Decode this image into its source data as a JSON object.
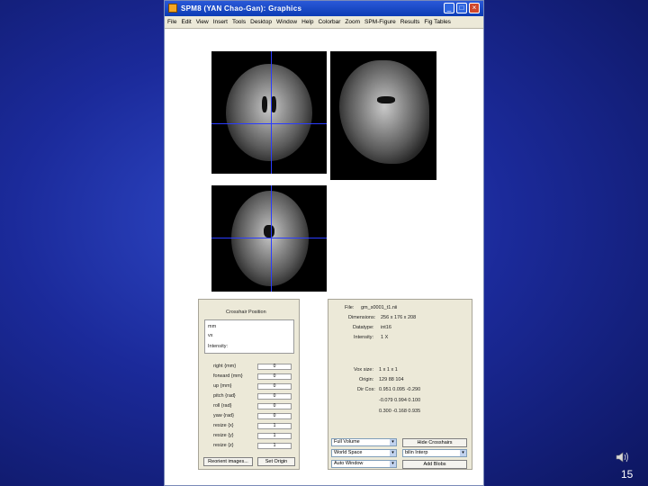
{
  "window": {
    "title": "SPM8 (YAN Chao-Gan): Graphics",
    "minimize_label": "_",
    "maximize_label": "□",
    "close_label": "×"
  },
  "menu": [
    "File",
    "Edit",
    "View",
    "Insert",
    "Tools",
    "Desktop",
    "Window",
    "Help",
    "Colorbar",
    "Zoom",
    "SPM-Figure",
    "Results",
    "Fig Tables"
  ],
  "reorient": {
    "title": "Crosshair Position",
    "list_items": [
      "mm",
      "vx",
      "Intensity:"
    ],
    "param_labels": [
      "right {mm}",
      "forward {mm}",
      "up {mm}",
      "pitch {rad}",
      "roll {rad}",
      "yaw {rad}",
      "resize {x}",
      "resize {y}",
      "resize {z}"
    ],
    "param_values": [
      "0",
      "0",
      "0",
      "0",
      "0",
      "0",
      "1",
      "1",
      "1"
    ],
    "reorient_button": "Reorient images...",
    "set_origin_button": "Set Origin"
  },
  "info": {
    "file_label": "File:",
    "file_value": "gm_s0001_t1.nii",
    "dimensions_label": "Dimensions:",
    "dimensions_value": "256 x 176 x 208",
    "datatype_label": "Datatype:",
    "datatype_value": "int16",
    "intensity_label": "Intensity:",
    "intensity_value": "1 X",
    "vox_label": "Vox size:",
    "vox_value": "1 x 1 x 1",
    "origin_label": "Origin:",
    "origin_value": "129 88 104",
    "dircos_label": "Dir Cos:",
    "dircos_rows": [
      "0.951 0.095 -0.290",
      "-0.079 0.994 0.100",
      "0.300 -0.168 0.935"
    ]
  },
  "controls": {
    "fov_select": "Full Volume",
    "space_select": "World Space",
    "window_select": "Auto Window",
    "hide_crosshairs_button": "Hide Crosshairs",
    "interp_select": "bilin Interp",
    "add_blobs_button": "Add Blobs"
  },
  "slide": {
    "page_number": "15"
  }
}
